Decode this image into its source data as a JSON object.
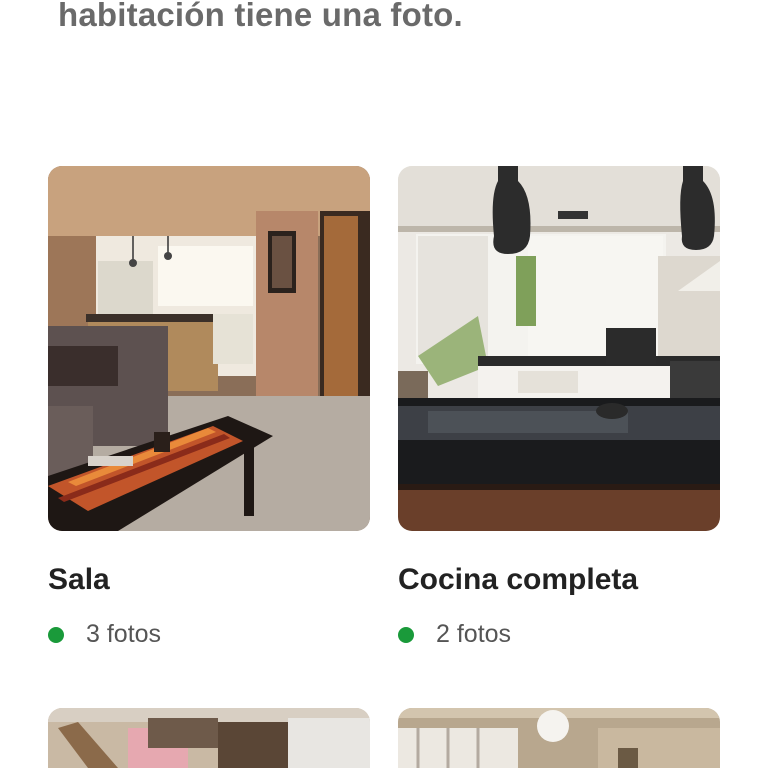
{
  "header": {
    "intro_text": "habitación tiene una foto."
  },
  "rooms": [
    {
      "name": "Sala",
      "count": "3 fotos",
      "status_color": "#1a9a3a",
      "icon": "living-room-photo"
    },
    {
      "name": "Cocina completa",
      "count": "2 fotos",
      "status_color": "#1a9a3a",
      "icon": "kitchen-photo"
    }
  ]
}
